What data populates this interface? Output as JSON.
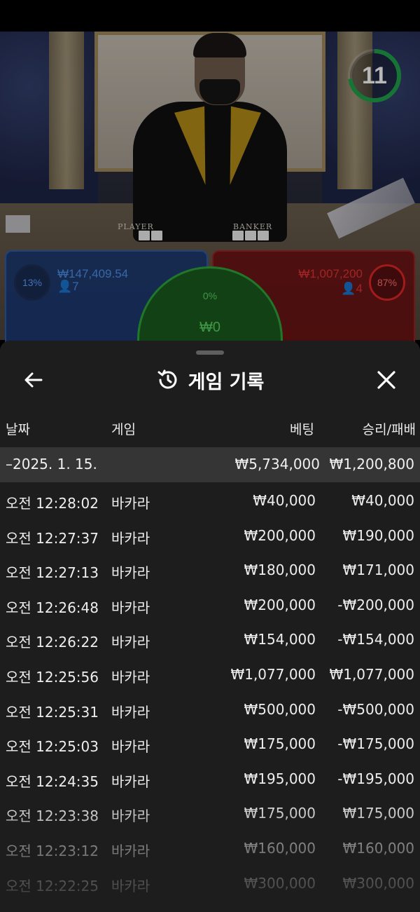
{
  "timer": {
    "seconds": "11",
    "ring_color": "#1fa34a"
  },
  "table": {
    "player_label": "PLAYER",
    "banker_label": "BANKER"
  },
  "bets": {
    "player": {
      "percent": "13%",
      "amount": "₩147,409.54",
      "count": "👤7",
      "color": "#2a5cb4"
    },
    "banker": {
      "percent": "87%",
      "amount": "₩1,007,200",
      "count": "👤4",
      "color": "#a41e1e"
    },
    "tie": {
      "percent": "0%",
      "amount": "₩0",
      "color": "#2ea53a"
    }
  },
  "sheet": {
    "title": "게임 기록",
    "history_icon": "history-icon",
    "back_icon": "arrow-left-icon",
    "close_icon": "close-icon",
    "columns": {
      "date": "날짜",
      "game": "게임",
      "bet": "베팅",
      "result": "승리/패배"
    },
    "date_group": {
      "label": "–2025. 1. 15.",
      "bet_total": "₩5,734,000",
      "result_total": "₩1,200,800"
    },
    "rows": [
      {
        "time": "오전 12:28:02",
        "game": "바카라",
        "bet": "₩40,000",
        "result": "₩40,000"
      },
      {
        "time": "오전 12:27:37",
        "game": "바카라",
        "bet": "₩200,000",
        "result": "₩190,000"
      },
      {
        "time": "오전 12:27:13",
        "game": "바카라",
        "bet": "₩180,000",
        "result": "₩171,000"
      },
      {
        "time": "오전 12:26:48",
        "game": "바카라",
        "bet": "₩200,000",
        "result": "-₩200,000"
      },
      {
        "time": "오전 12:26:22",
        "game": "바카라",
        "bet": "₩154,000",
        "result": "-₩154,000"
      },
      {
        "time": "오전 12:25:56",
        "game": "바카라",
        "bet": "₩1,077,000",
        "result": "₩1,077,000"
      },
      {
        "time": "오전 12:25:31",
        "game": "바카라",
        "bet": "₩500,000",
        "result": "-₩500,000"
      },
      {
        "time": "오전 12:25:03",
        "game": "바카라",
        "bet": "₩175,000",
        "result": "-₩175,000"
      },
      {
        "time": "오전 12:24:35",
        "game": "바카라",
        "bet": "₩195,000",
        "result": "-₩195,000"
      },
      {
        "time": "오전 12:23:38",
        "game": "바카라",
        "bet": "₩175,000",
        "result": "₩175,000"
      },
      {
        "time": "오전 12:23:12",
        "game": "바카라",
        "bet": "₩160,000",
        "result": "₩160,000"
      },
      {
        "time": "오전 12:22:25",
        "game": "바카라",
        "bet": "₩300,000",
        "result": "₩300,000"
      }
    ]
  }
}
